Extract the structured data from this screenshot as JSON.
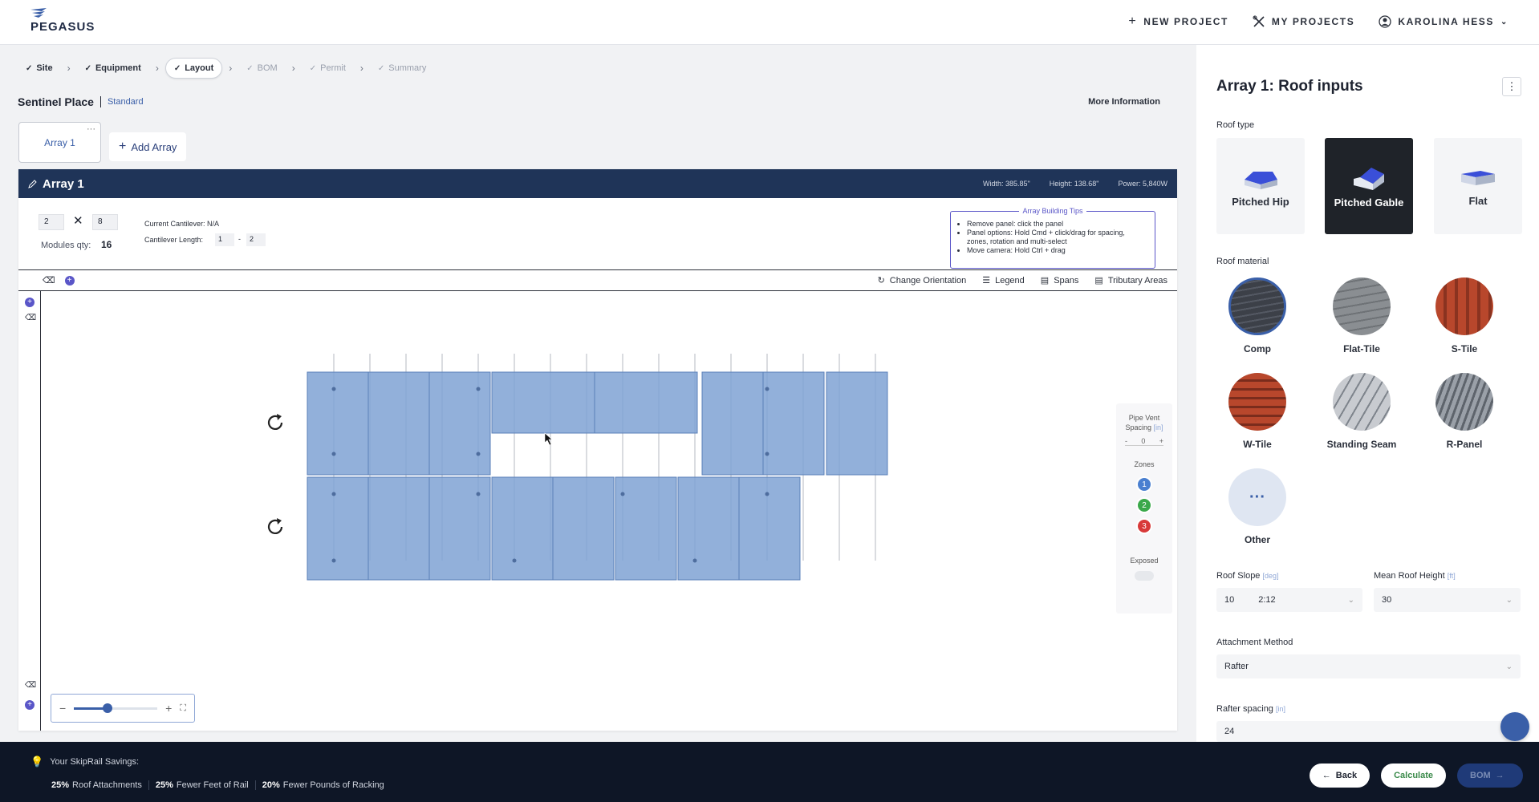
{
  "brand": {
    "name": "PEGASUS"
  },
  "topnav": {
    "new_project": "NEW PROJECT",
    "my_projects": "MY PROJECTS",
    "user": "KAROLINA HESS"
  },
  "stepper": [
    "Site",
    "Equipment",
    "Layout",
    "BOM",
    "Permit",
    "Summary"
  ],
  "project": {
    "name": "Sentinel Place",
    "type": "Standard",
    "more_info": "More Information"
  },
  "arrays": {
    "tab": "Array 1",
    "add": "Add Array"
  },
  "array": {
    "title": "Array 1",
    "width": "Width: 385.85\"",
    "height": "Height: 138.68\"",
    "power": "Power: 5,840W",
    "rows": "2",
    "cols": "8",
    "modules_label": "Modules qty:",
    "modules_qty": "16",
    "current_cantilever": "Current Cantilever:  N/A",
    "cantilever_length": "Cantilever Length:",
    "cant_min": "1",
    "cant_sep": "-",
    "cant_max": "2",
    "tips_title": "Array Building Tips",
    "tips": [
      "Remove panel: click the panel",
      "Panel options: Hold Cmd + click/drag for spacing, zones, rotation and multi-select",
      "Move camera: Hold Ctrl + drag"
    ]
  },
  "toolbar": {
    "change_orientation": "Change Orientation",
    "legend": "Legend",
    "spans": "Spans",
    "tributary": "Tributary Areas"
  },
  "side_widget": {
    "pipe_vent": "Pipe Vent Spacing",
    "pipe_unit": "[in]",
    "pipe_value": "0",
    "minus": "-",
    "plus": "+",
    "zones": "Zones",
    "zone_labels": [
      "1",
      "2",
      "3"
    ],
    "exposed": "Exposed"
  },
  "zoom": {
    "minus": "−",
    "plus": "+",
    "level": 0.4
  },
  "right_panel": {
    "title": "Array 1: Roof inputs",
    "roof_type_label": "Roof type",
    "roof_types": [
      "Pitched Hip",
      "Pitched Gable",
      "Flat"
    ],
    "selected_roof_type": "Pitched Gable",
    "roof_material_label": "Roof material",
    "materials": [
      "Comp",
      "Flat-Tile",
      "S-Tile",
      "W-Tile",
      "Standing Seam",
      "R-Panel",
      "Other"
    ],
    "selected_material": "Comp",
    "slope_label": "Roof Slope",
    "slope_unit": "[deg]",
    "slope_value": "10",
    "slope_ratio": "2:12",
    "height_label": "Mean Roof Height",
    "height_unit": "[ft]",
    "height_value": "30",
    "attach_label": "Attachment Method",
    "attach_value": "Rafter",
    "rafter_label": "Rafter spacing",
    "rafter_unit": "[in]",
    "rafter_value": "24"
  },
  "bottom": {
    "savings_title": "Your SkipRail Savings:",
    "savings": [
      {
        "pct": "25%",
        "label": "Roof Attachments"
      },
      {
        "pct": "25%",
        "label": "Fewer Feet of Rail"
      },
      {
        "pct": "20%",
        "label": "Fewer Pounds of Racking"
      }
    ],
    "back": "Back",
    "calculate": "Calculate",
    "bom": "BOM"
  },
  "colors": {
    "navy": "#1f3458",
    "panel_fill": "#7fa2d4",
    "accent_purple": "#5a56c8",
    "zone1": "#4a7fd0",
    "zone2": "#3aa84a",
    "zone3": "#d83a3a"
  }
}
